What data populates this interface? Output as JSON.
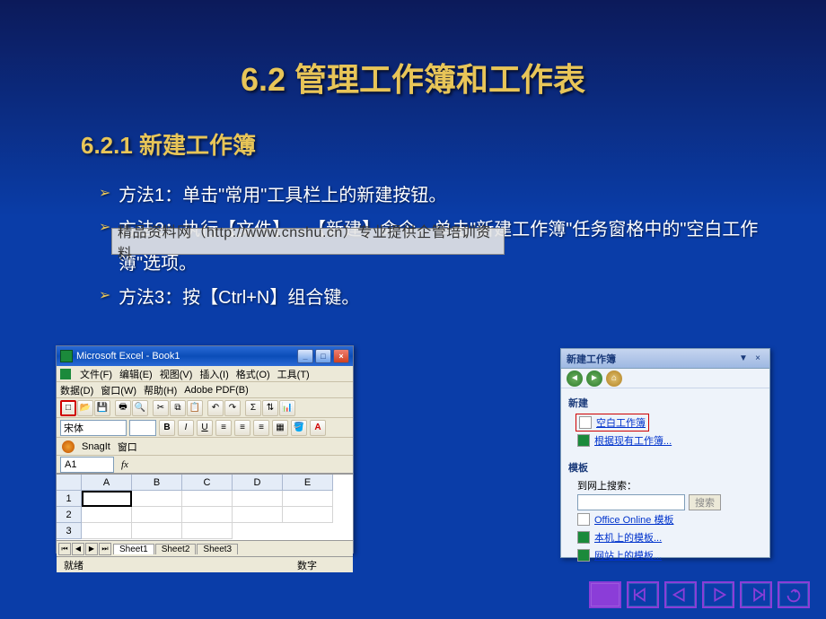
{
  "slide": {
    "title": "6.2  管理工作簿和工作表",
    "subtitle": "6.2.1  新建工作簿",
    "bullets": [
      "方法1：单击\"常用\"工具栏上的新建按钮。",
      "方法2：执行【文件】→【新建】命令，单击\"新建工作簿\"任务窗格中的\"空白工作簿\"选项。",
      "方法3：按【Ctrl+N】组合键。"
    ],
    "watermark": "精品资料网（http://www.cnshu.cn）专业提供企管培训资料"
  },
  "excel": {
    "title": "Microsoft Excel - Book1",
    "menu1": [
      "文件(F)",
      "编辑(E)",
      "视图(V)",
      "插入(I)",
      "格式(O)",
      "工具(T)"
    ],
    "menu2": [
      "数据(D)",
      "窗口(W)",
      "帮助(H)",
      "Adobe PDF(B)"
    ],
    "font": "宋体",
    "snagit": "SnagIt",
    "snagit_win": "窗口",
    "namebox": "A1",
    "fx": "fx",
    "cols": [
      "A",
      "B",
      "C",
      "D",
      "E"
    ],
    "rows": [
      "1",
      "2",
      "3"
    ],
    "sheets": [
      "Sheet1",
      "Sheet2",
      "Sheet3"
    ],
    "status": "就绪",
    "statusR": "数字"
  },
  "taskpane": {
    "title": "新建工作簿",
    "sec_new": "新建",
    "link_blank": "空白工作簿",
    "link_existing": "根据现有工作簿...",
    "sec_tpl": "模板",
    "search_label": "到网上搜索：",
    "search_btn": "搜索",
    "link_online": "Office Online 模板",
    "link_local": "本机上的模板...",
    "link_web": "网站上的模板..."
  },
  "nav": {
    "btns": [
      "filled",
      "first",
      "prev",
      "next",
      "last",
      "return"
    ]
  }
}
